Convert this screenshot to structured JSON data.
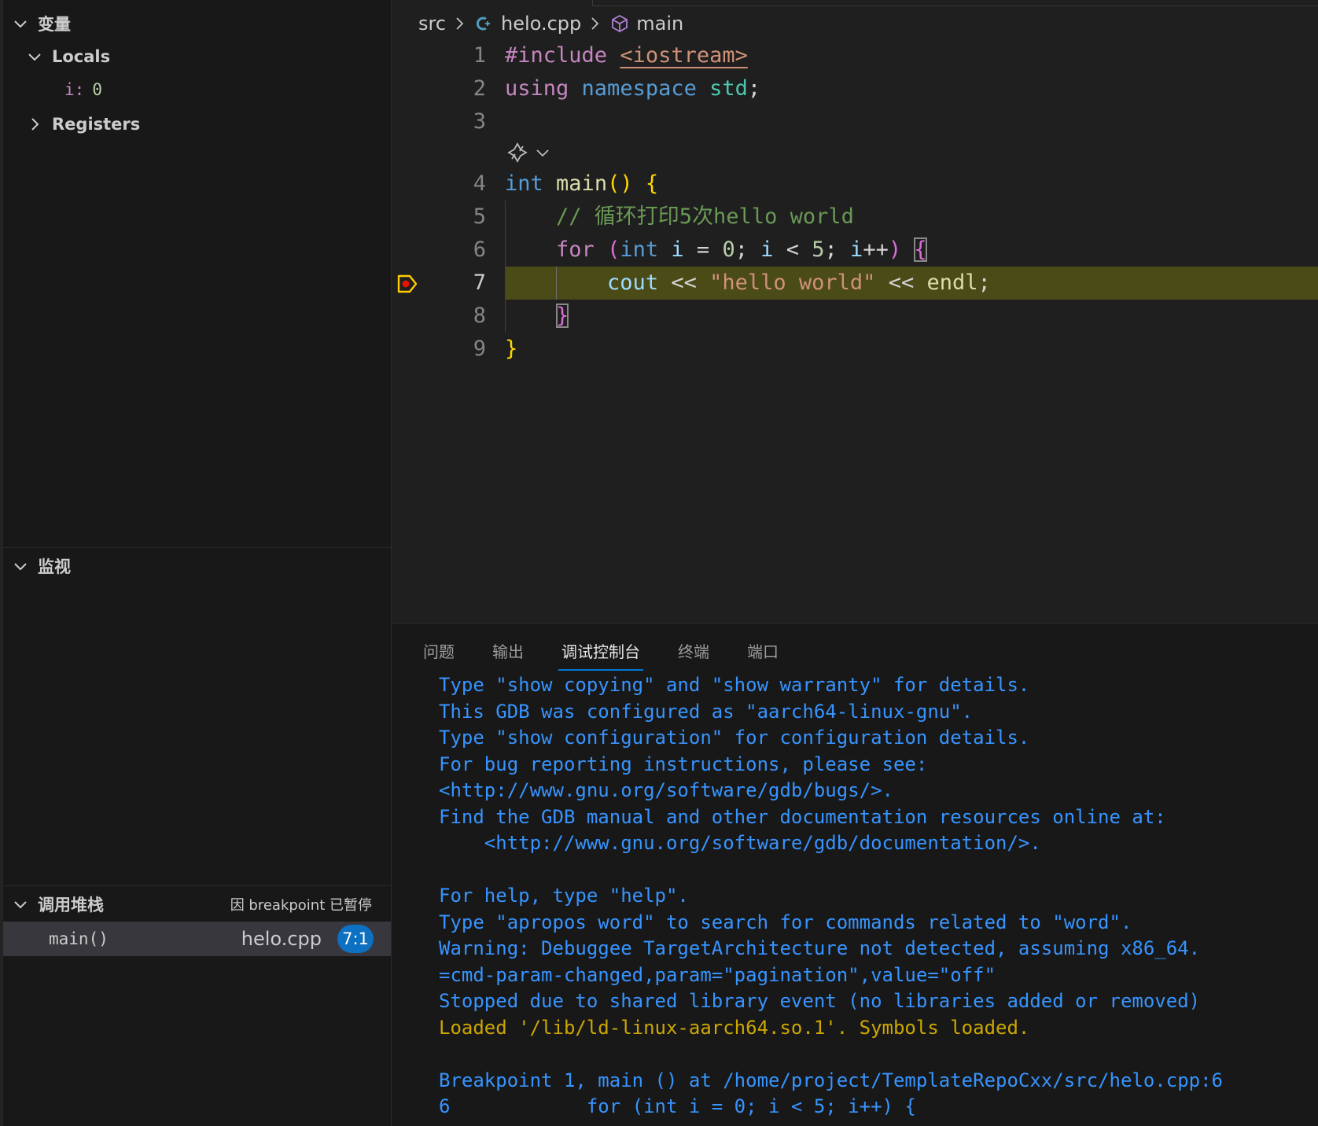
{
  "sidebar": {
    "variables": {
      "title": "变量",
      "locals_label": "Locals",
      "locals": [
        {
          "name": "i",
          "value": "0"
        }
      ],
      "registers_label": "Registers"
    },
    "watch": {
      "title": "监视"
    },
    "callstack": {
      "title": "调用堆栈",
      "status": "因 breakpoint 已暂停",
      "frames": [
        {
          "name": "main()",
          "file": "helo.cpp",
          "position": "7:1"
        }
      ]
    }
  },
  "editor": {
    "breadcrumb": {
      "folder": "src",
      "file": "helo.cpp",
      "symbol": "main"
    },
    "current_line": 7,
    "line_numbers": [
      "1",
      "2",
      "3",
      "4",
      "5",
      "6",
      "7",
      "8",
      "9"
    ]
  },
  "panel": {
    "tabs": [
      "问题",
      "输出",
      "调试控制台",
      "终端",
      "端口"
    ],
    "active_tab": "调试控制台",
    "console_lines": [
      {
        "text": "Type \"show copying\" and \"show warranty\" for details.",
        "color": "blue"
      },
      {
        "text": "This GDB was configured as \"aarch64-linux-gnu\".",
        "color": "blue"
      },
      {
        "text": "Type \"show configuration\" for configuration details.",
        "color": "blue"
      },
      {
        "text": "For bug reporting instructions, please see:",
        "color": "blue"
      },
      {
        "text": "<http://www.gnu.org/software/gdb/bugs/>.",
        "color": "blue"
      },
      {
        "text": "Find the GDB manual and other documentation resources online at:",
        "color": "blue"
      },
      {
        "text": "    <http://www.gnu.org/software/gdb/documentation/>.",
        "color": "blue"
      },
      {
        "text": "",
        "color": "blue"
      },
      {
        "text": "For help, type \"help\".",
        "color": "blue"
      },
      {
        "text": "Type \"apropos word\" to search for commands related to \"word\".",
        "color": "blue"
      },
      {
        "text": "Warning: Debuggee TargetArchitecture not detected, assuming x86_64.",
        "color": "blue"
      },
      {
        "text": "=cmd-param-changed,param=\"pagination\",value=\"off\"",
        "color": "blue"
      },
      {
        "text": "Stopped due to shared library event (no libraries added or removed)",
        "color": "blue"
      },
      {
        "text": "Loaded '/lib/ld-linux-aarch64.so.1'. Symbols loaded.",
        "color": "yellow"
      },
      {
        "text": "",
        "color": "blue"
      },
      {
        "text": "Breakpoint 1, main () at /home/project/TemplateRepoCxx/src/helo.cpp:6",
        "color": "blue"
      },
      {
        "text": "6            for (int i = 0; i < 5; i++) {",
        "color": "blue"
      }
    ]
  },
  "colors": {
    "accent": "#0078d4",
    "badge": "#0e70c0",
    "current_line_highlight": "#4b4b18",
    "console_text": "#3794ff",
    "console_warn": "#cca700"
  }
}
